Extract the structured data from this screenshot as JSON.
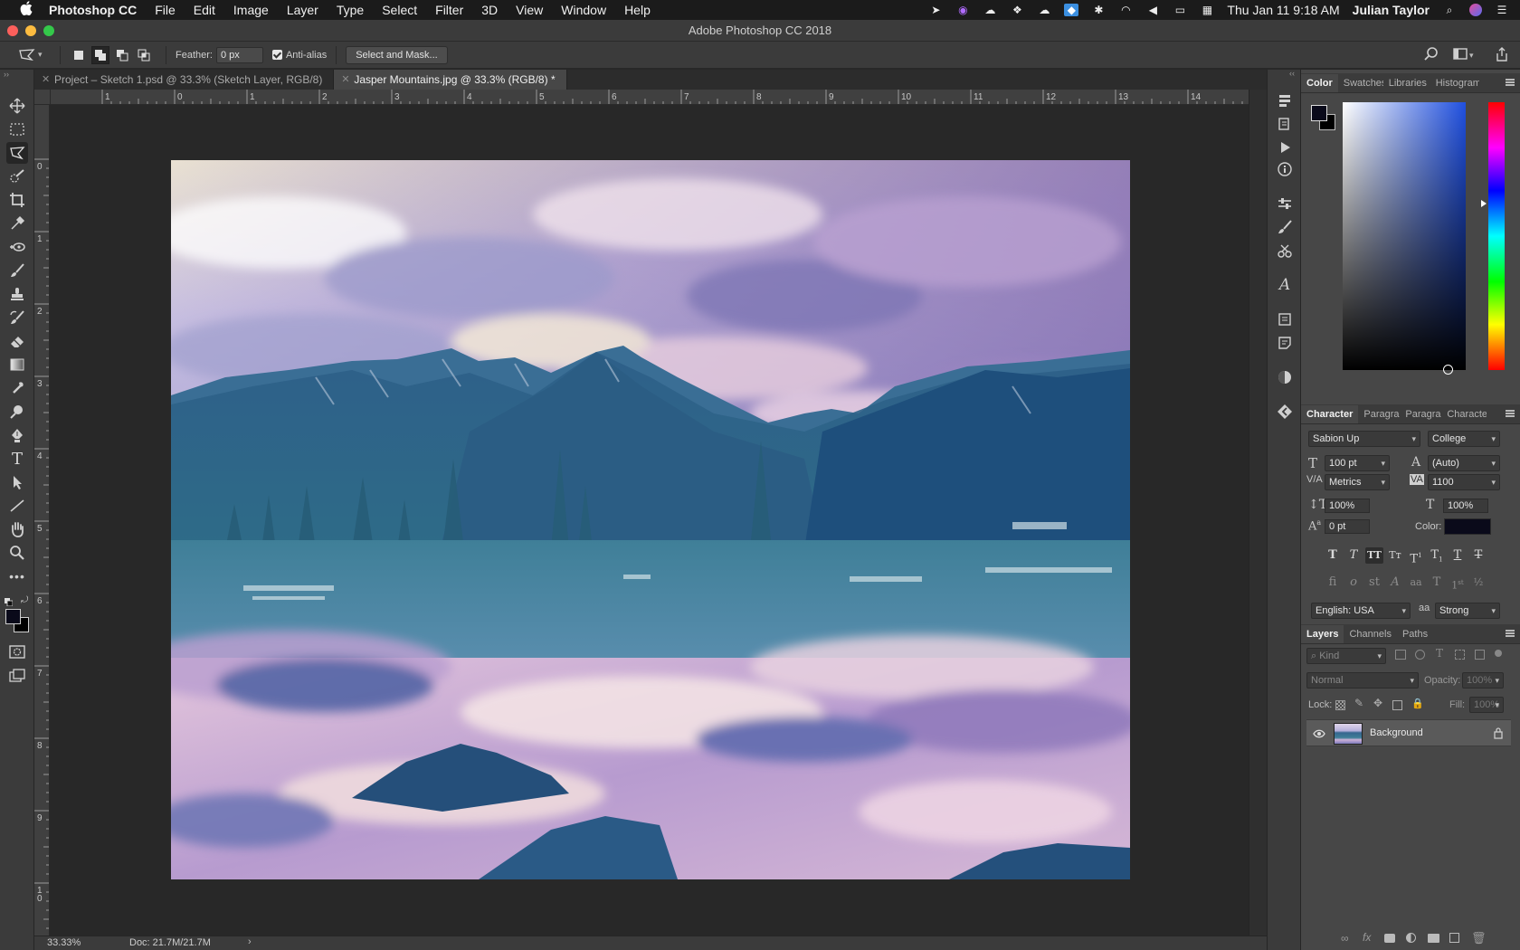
{
  "menubar": {
    "app_name": "Photoshop CC",
    "items": [
      "File",
      "Edit",
      "Image",
      "Layer",
      "Type",
      "Select",
      "Filter",
      "3D",
      "View",
      "Window",
      "Help"
    ],
    "clock": "Thu Jan 11  9:18 AM",
    "user": "Julian Taylor"
  },
  "window": {
    "title": "Adobe Photoshop CC 2018"
  },
  "options": {
    "feather_label": "Feather:",
    "feather_value": "0 px",
    "antialias_label": "Anti-alias",
    "select_mask_label": "Select and Mask..."
  },
  "tabs": [
    {
      "label": "Project – Sketch 1.psd @ 33.3% (Sketch Layer, RGB/8)"
    },
    {
      "label": "Jasper Mountains.jpg @ 33.3% (RGB/8) *"
    }
  ],
  "rulers": {
    "h_labels": [
      "1",
      "0",
      "1",
      "2",
      "3",
      "4",
      "5",
      "6",
      "7",
      "8",
      "9",
      "10",
      "11",
      "12",
      "13",
      "14"
    ],
    "v_labels": [
      "0",
      "1",
      "2",
      "3",
      "4",
      "5",
      "6",
      "7",
      "8",
      "9",
      "1\n0"
    ]
  },
  "status": {
    "zoom": "33.33%",
    "doc": "Doc: 21.7M/21.7M"
  },
  "color_panel": {
    "tabs": [
      "Color",
      "Swatches",
      "Libraries",
      "Histogram"
    ]
  },
  "character_panel": {
    "tabs": [
      "Character",
      "Paragraph",
      "Paragraph Styles",
      "Character Styles"
    ],
    "font_family": "Sabion Up",
    "font_style": "College",
    "size": "100 pt",
    "leading": "(Auto)",
    "kerning": "Metrics",
    "tracking": "1100",
    "vertical_scale": "100%",
    "horizontal_scale": "100%",
    "baseline_shift": "0 pt",
    "color_label": "Color:",
    "language": "English: USA",
    "antialias": "Strong",
    "antialias_icon_text": "aa"
  },
  "layers_panel": {
    "tabs": [
      "Layers",
      "Channels",
      "Paths"
    ],
    "filter_placeholder": "Kind",
    "blend_mode": "Normal",
    "opacity_label": "Opacity:",
    "opacity_value": "100%",
    "lock_label": "Lock:",
    "fill_label": "Fill:",
    "fill_value": "100%",
    "layers": [
      {
        "name": "Background"
      }
    ]
  },
  "colors": {
    "accent": "#2f6fd6",
    "foreground": "#0a0a1a"
  }
}
